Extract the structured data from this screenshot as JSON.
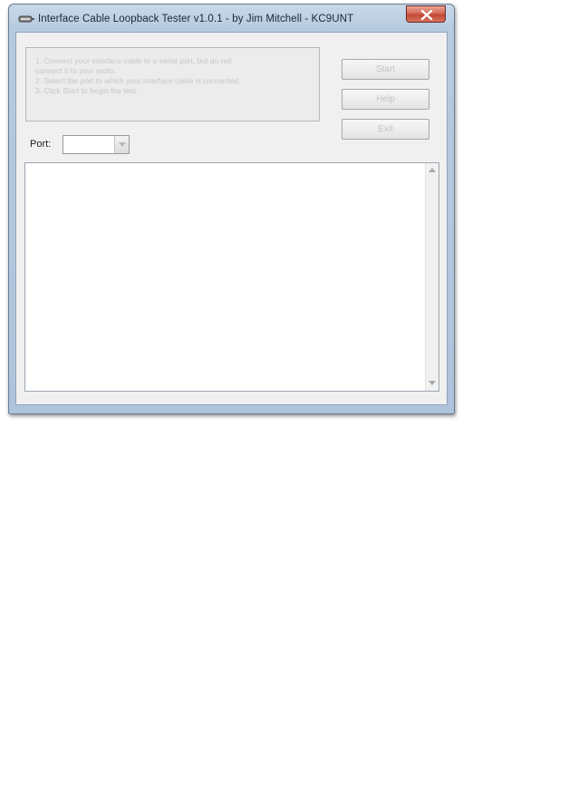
{
  "window": {
    "title": "Interface Cable Loopback Tester v1.0.1 - by Jim Mitchell - KC9UNT"
  },
  "instructions": {
    "lines": [
      "1. Connect your interface cable to a serial port, but do not",
      "   connect it to your radio.",
      "2. Select the port to which your interface cable is connected.",
      "3. Click Start to begin the test."
    ]
  },
  "buttons": {
    "start": "Start",
    "help": "Help",
    "exit": "Exit"
  },
  "port": {
    "label": "Port:",
    "value": ""
  },
  "output": {
    "text": ""
  },
  "icons": {
    "app": "cable-icon",
    "close": "close-icon",
    "dropdown": "chevron-down-icon",
    "scroll_up": "arrow-up-icon",
    "scroll_down": "arrow-down-icon"
  },
  "colors": {
    "close_button": "#c74a36",
    "title_bar": "#bcd0e6"
  }
}
